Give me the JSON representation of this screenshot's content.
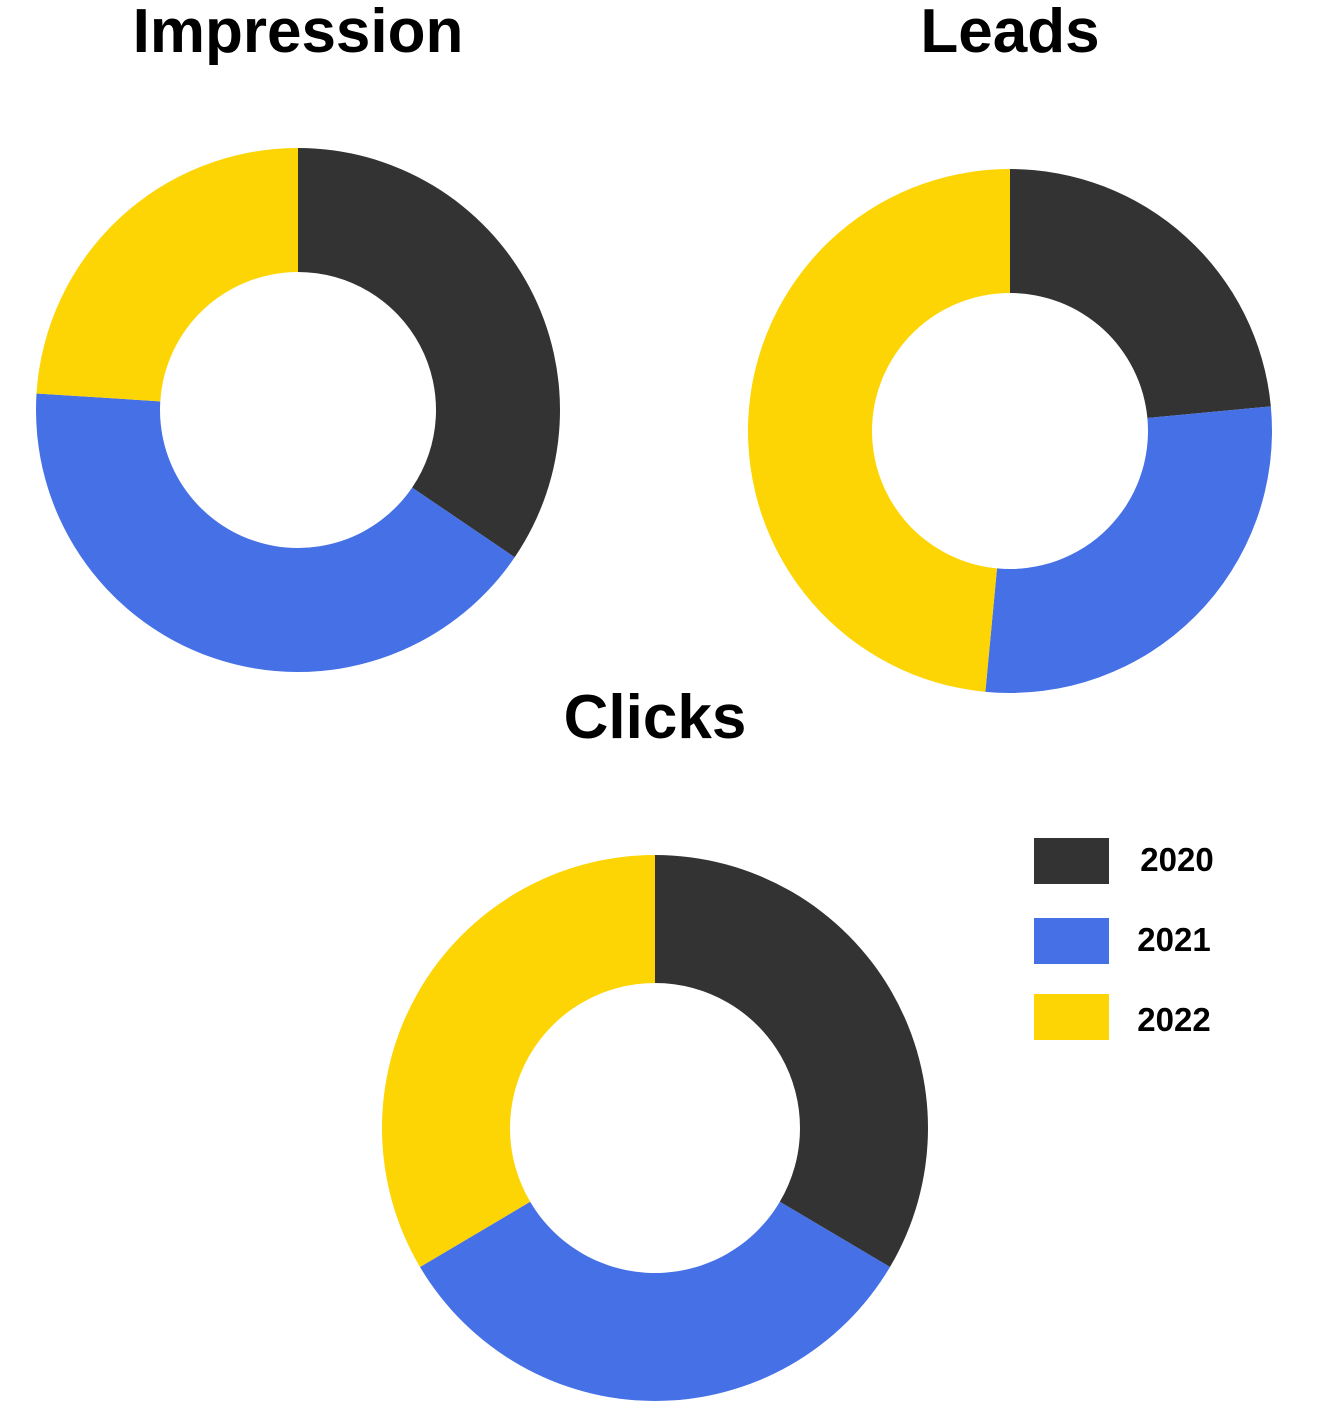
{
  "chart_data": [
    {
      "type": "pie",
      "style": "donut",
      "title": "Impression",
      "series": [
        {
          "name": "2020",
          "value": 34.5
        },
        {
          "name": "2021",
          "value": 41.5
        },
        {
          "name": "2022",
          "value": 24.0
        }
      ]
    },
    {
      "type": "pie",
      "style": "donut",
      "title": "Leads",
      "series": [
        {
          "name": "2020",
          "value": 23.5
        },
        {
          "name": "2021",
          "value": 28.0
        },
        {
          "name": "2022",
          "value": 48.5
        }
      ]
    },
    {
      "type": "pie",
      "style": "donut",
      "title": "Clicks",
      "series": [
        {
          "name": "2020",
          "value": 33.5
        },
        {
          "name": "2021",
          "value": 33.0
        },
        {
          "name": "2022",
          "value": 33.5
        }
      ]
    }
  ],
  "legend": {
    "placement": "right",
    "items": [
      {
        "label": "2020",
        "color": "#333333"
      },
      {
        "label": "2021",
        "color": "#4570E6"
      },
      {
        "label": "2022",
        "color": "#FDD404"
      }
    ]
  }
}
